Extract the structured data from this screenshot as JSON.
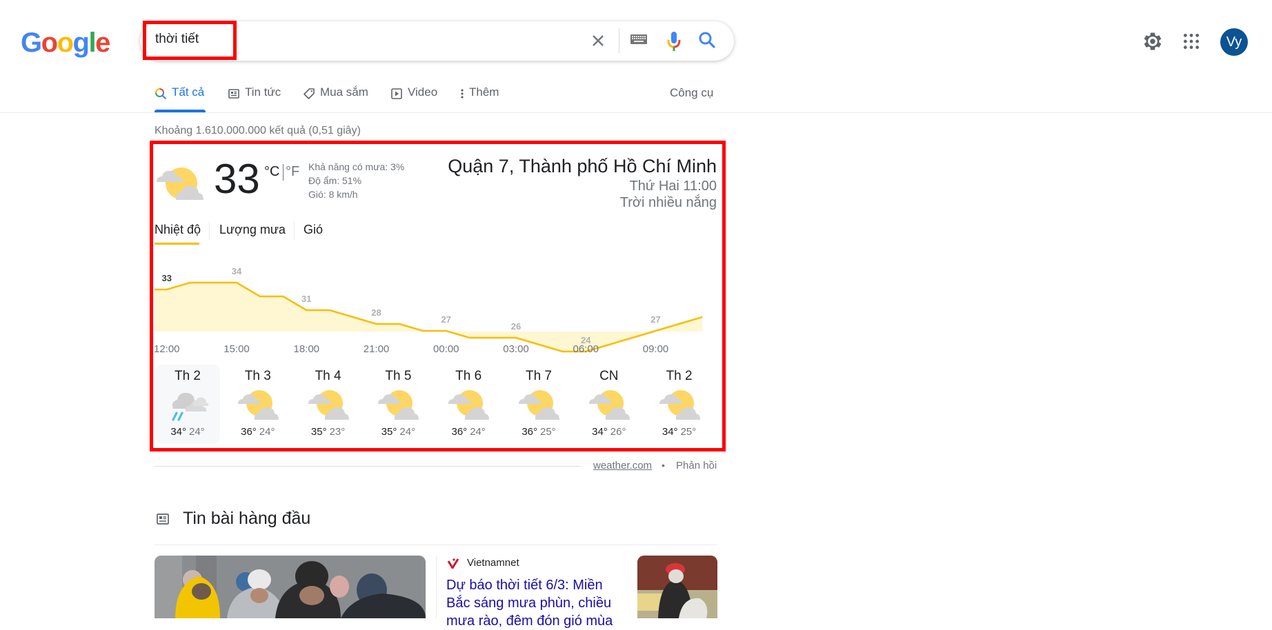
{
  "header": {
    "logo_letters": [
      {
        "ch": "G",
        "color": "#4285F4"
      },
      {
        "ch": "o",
        "color": "#EA4335"
      },
      {
        "ch": "o",
        "color": "#FBBC05"
      },
      {
        "ch": "g",
        "color": "#4285F4"
      },
      {
        "ch": "l",
        "color": "#34A853"
      },
      {
        "ch": "e",
        "color": "#EA4335"
      }
    ],
    "search_query": "thời tiết",
    "avatar_initials": "Vy",
    "avatar_color": "#0b5394"
  },
  "tabs": [
    {
      "label": "Tất cả",
      "icon": "search-icon",
      "active": true
    },
    {
      "label": "Tin tức",
      "icon": "news-icon",
      "active": false
    },
    {
      "label": "Mua sắm",
      "icon": "tag-icon",
      "active": false
    },
    {
      "label": "Video",
      "icon": "play-icon",
      "active": false
    },
    {
      "label": "Thêm",
      "icon": "more-vert-icon",
      "active": false
    }
  ],
  "tools_label": "Công cụ",
  "result_stats": "Khoảng 1.610.000.000 kết quả (0,51 giây)",
  "weather": {
    "current_temp": "33",
    "unit_c": "°C",
    "unit_f": "°F",
    "precip": "Khả năng có mưa: 3%",
    "humidity": "Độ ẩm: 51%",
    "wind": "Gió: 8 km/h",
    "location": "Quận 7, Thành phố Hồ Chí Minh",
    "datetime": "Thứ Hai 11:00",
    "condition": "Trời nhiều nắng",
    "tabs": [
      "Nhiệt độ",
      "Lượng mưa",
      "Gió"
    ],
    "active_tab": 0,
    "forecast": [
      {
        "day": "Th 2",
        "icon": "rain-cloud-icon",
        "hi": "34°",
        "lo": "24°",
        "selected": true
      },
      {
        "day": "Th 3",
        "icon": "partly-sunny-icon",
        "hi": "36°",
        "lo": "24°",
        "selected": false
      },
      {
        "day": "Th 4",
        "icon": "partly-sunny-icon",
        "hi": "35°",
        "lo": "23°",
        "selected": false
      },
      {
        "day": "Th 5",
        "icon": "partly-sunny-icon",
        "hi": "35°",
        "lo": "24°",
        "selected": false
      },
      {
        "day": "Th 6",
        "icon": "partly-sunny-icon",
        "hi": "36°",
        "lo": "24°",
        "selected": false
      },
      {
        "day": "Th 7",
        "icon": "partly-sunny-icon",
        "hi": "36°",
        "lo": "25°",
        "selected": false
      },
      {
        "day": "CN",
        "icon": "partly-sunny-icon",
        "hi": "34°",
        "lo": "26°",
        "selected": false
      },
      {
        "day": "Th 2",
        "icon": "partly-sunny-icon",
        "hi": "34°",
        "lo": "25°",
        "selected": false
      }
    ],
    "source": "weather.com",
    "feedback": "Phản hồi",
    "accent_color": "#fbbc04"
  },
  "chart_data": {
    "type": "area",
    "title": "Nhiệt độ",
    "x_tick_labels": [
      "12:00",
      "15:00",
      "18:00",
      "21:00",
      "00:00",
      "03:00",
      "06:00",
      "09:00"
    ],
    "hours": [
      "11:00",
      "12:00",
      "13:00",
      "14:00",
      "15:00",
      "16:00",
      "17:00",
      "18:00",
      "19:00",
      "20:00",
      "21:00",
      "22:00",
      "23:00",
      "00:00",
      "01:00",
      "02:00",
      "03:00",
      "04:00",
      "05:00",
      "06:00",
      "07:00",
      "08:00",
      "09:00",
      "10:00",
      "11:00"
    ],
    "values": [
      33,
      33,
      34,
      34,
      34,
      32,
      32,
      30,
      30,
      29,
      28,
      28,
      27,
      27,
      26,
      26,
      26,
      25,
      24,
      24,
      25,
      26,
      27,
      28,
      29
    ],
    "point_labels": [
      {
        "hour_index": 1,
        "value": "33",
        "highlight": true
      },
      {
        "hour_index": 4,
        "value": "34"
      },
      {
        "hour_index": 7,
        "value": "31"
      },
      {
        "hour_index": 10,
        "value": "28"
      },
      {
        "hour_index": 13,
        "value": "27"
      },
      {
        "hour_index": 16,
        "value": "26"
      },
      {
        "hour_index": 19,
        "value": "24"
      },
      {
        "hour_index": 22,
        "value": "27"
      }
    ],
    "unit": "°C",
    "line_color": "#fbbc04",
    "fill_color": "#fef7d2"
  },
  "top_stories": {
    "heading": "Tin bài hàng đầu",
    "items": [
      {
        "source": "Vietnamnet",
        "title": "Dự báo thời tiết 6/3: Miền Bắc sáng mưa phùn, chiều mưa rào, đêm đón gió mùa"
      }
    ]
  }
}
